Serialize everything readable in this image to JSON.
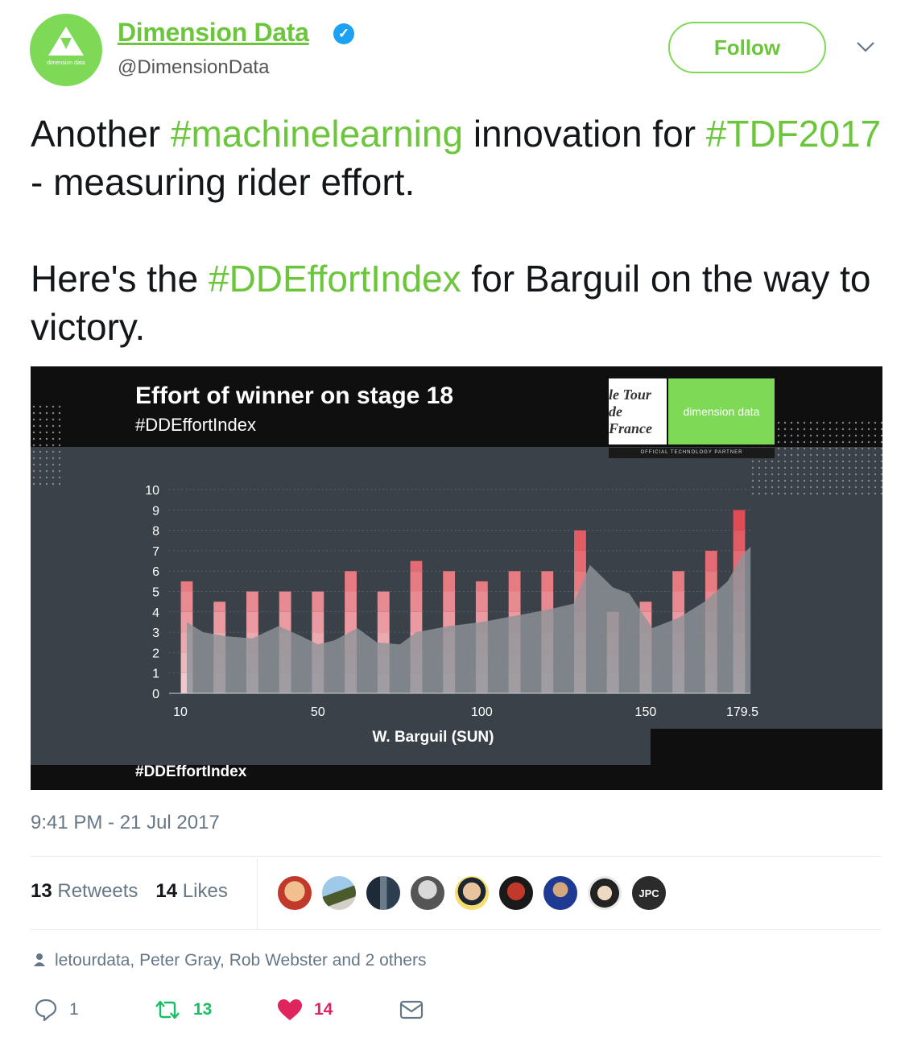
{
  "user": {
    "name": "Dimension Data",
    "handle": "@DimensionData",
    "avatar_text": "dimension data",
    "follow_label": "Follow"
  },
  "tweet": {
    "line1": [
      {
        "text": "Another ",
        "tag": false
      },
      {
        "text": "#machinelearning",
        "tag": true
      },
      {
        "text": " innovation for ",
        "tag": false
      },
      {
        "text": "#TDF2017",
        "tag": true
      },
      {
        "text": " - measuring rider effort.",
        "tag": false
      }
    ],
    "line2": [
      {
        "text": "Here's the ",
        "tag": false
      },
      {
        "text": "#DDEffortIndex",
        "tag": true
      },
      {
        "text": " for Barguil on the way to victory.",
        "tag": false
      }
    ]
  },
  "media": {
    "title": "Effort of winner on stage 18",
    "subtitle": "#DDEffortIndex",
    "footer": "#DDEffortIndex",
    "sponsor_tdf": "le Tour de France",
    "sponsor_dd": "dimension data",
    "sponsor_note": "OFFICIAL TECHNOLOGY PARTNER"
  },
  "chart_data": {
    "type": "bar",
    "xlabel": "W. Barguil (SUN)",
    "ylabel": "",
    "ylim": [
      0,
      10
    ],
    "y_ticks": [
      "0",
      "1",
      "2",
      "3",
      "4",
      "5",
      "6",
      "7",
      "8",
      "9",
      "10"
    ],
    "x_ticks": [
      {
        "label": "10",
        "value": 10
      },
      {
        "label": "50",
        "value": 50
      },
      {
        "label": "100",
        "value": 100
      },
      {
        "label": "150",
        "value": 150
      },
      {
        "label": "179.5",
        "value": 179.5
      }
    ],
    "xlim": [
      10,
      179.5
    ],
    "series": [
      {
        "type": "bar",
        "x": [
          10,
          20,
          30,
          40,
          50,
          60,
          70,
          80,
          90,
          100,
          110,
          120,
          130,
          140,
          150,
          160,
          170,
          179.5
        ],
        "values": [
          5.5,
          4.5,
          5,
          5,
          5,
          6,
          5,
          6.5,
          6,
          5.5,
          6,
          6,
          8,
          4,
          4.5,
          6,
          7,
          9
        ]
      },
      {
        "type": "area",
        "x": [
          10,
          15,
          22,
          30,
          38,
          45,
          50,
          55,
          62,
          68,
          75,
          80,
          90,
          100,
          110,
          120,
          128,
          133,
          140,
          145,
          152,
          160,
          168,
          175,
          179.5,
          182
        ],
        "values": [
          3.5,
          3,
          2.8,
          2.7,
          3.3,
          2.8,
          2.4,
          2.6,
          3.2,
          2.5,
          2.4,
          3.0,
          3.3,
          3.5,
          3.8,
          4.1,
          4.4,
          6.3,
          5.2,
          4.9,
          3.2,
          3.7,
          4.5,
          5.5,
          6.8,
          7.2
        ]
      }
    ]
  },
  "meta": {
    "timestamp": "9:41 PM - 21 Jul 2017",
    "retweets_count": "13",
    "retweets_label": "Retweets",
    "likes_count": "14",
    "likes_label": "Likes",
    "liked_by": "letourdata, Peter Gray, Rob Webster and 2 others",
    "reply_count": "1",
    "retweet_action_count": "13",
    "like_action_count": "14",
    "avatar_badge_text": "JPC"
  },
  "colors": {
    "accent": "#6cc63c",
    "bar": "#e0313f",
    "area": "#8d9499",
    "heart": "#e0245e",
    "retweet": "#17bf63"
  }
}
